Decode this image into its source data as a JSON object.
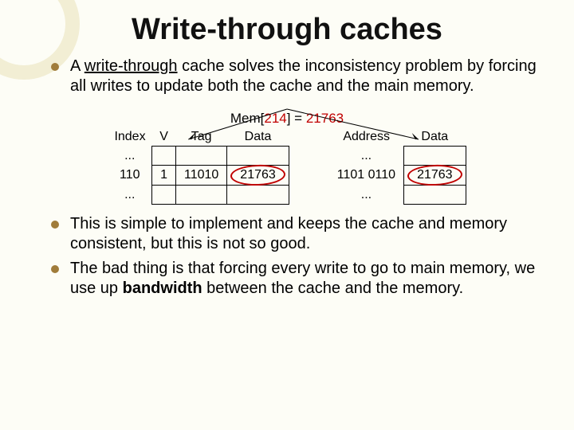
{
  "title": "Write-through caches",
  "bullets": {
    "b1_a": "A ",
    "b1_u": "write-through",
    "b1_b": " cache solves the inconsistency problem by forcing all writes to update both the cache and the main memory.",
    "b2": "This is simple to implement and keeps the cache and memory consistent, but this is not so good.",
    "b3_a": "The bad thing is that forcing every write to go to main memory, we use up ",
    "b3_bold": "bandwidth",
    "b3_b": " between the cache and the memory."
  },
  "mem": {
    "prefix": "Mem[",
    "addr": "214",
    "mid": "] = ",
    "val": "21763"
  },
  "cache_table": {
    "h_index": "Index",
    "h_v": "V",
    "h_tag": "Tag",
    "h_data": "Data",
    "dots": "...",
    "r_index": "110",
    "r_v": "1",
    "r_tag": "11010",
    "r_data": "21763"
  },
  "mem_table": {
    "h_addr": "Address",
    "h_data": "Data",
    "dots": "...",
    "r_addr": "1101 0110",
    "r_data": "21763"
  }
}
